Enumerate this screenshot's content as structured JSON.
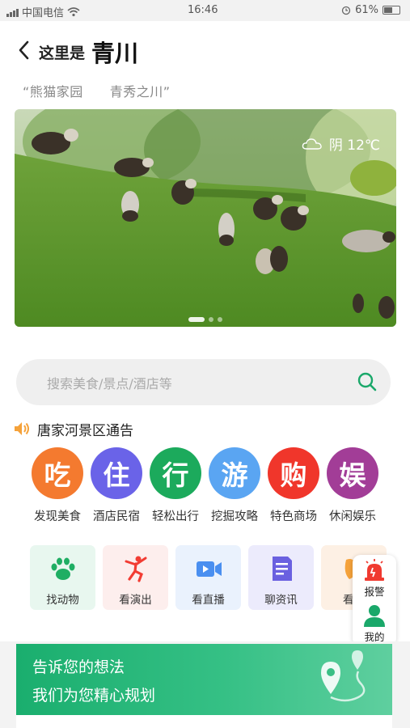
{
  "status_bar": {
    "carrier": "中国电信",
    "time": "16:46",
    "battery": "61%"
  },
  "header": {
    "prefix": "这里是",
    "title": "青川",
    "subtitle": "“熊猫家园　　青秀之川”"
  },
  "banner": {
    "weather_text": "阴 12℃",
    "weather_icon": "cloud-icon",
    "slide_count": 3,
    "active_slide": 1
  },
  "search": {
    "placeholder": "搜索美食/景点/酒店等",
    "icon": "search-icon"
  },
  "notice": {
    "icon": "speaker-icon",
    "text": "唐家河景区通告"
  },
  "categories": [
    {
      "char": "吃",
      "label": "发现美食",
      "color": "#f47a2f"
    },
    {
      "char": "住",
      "label": "酒店民宿",
      "color": "#6a63e8"
    },
    {
      "char": "行",
      "label": "轻松出行",
      "color": "#1caa5c"
    },
    {
      "char": "游",
      "label": "挖掘攻略",
      "color": "#5aa5f2"
    },
    {
      "char": "购",
      "label": "特色商场",
      "color": "#f0362b"
    },
    {
      "char": "娱",
      "label": "休闲娱乐",
      "color": "#a23d97"
    }
  ],
  "cards": [
    {
      "label": "找动物",
      "icon": "paw-icon",
      "bg": "#e8f7ef",
      "color": "#1fae63"
    },
    {
      "label": "看演出",
      "icon": "dancer-icon",
      "bg": "#fdeeed",
      "color": "#f23c33"
    },
    {
      "label": "看直播",
      "icon": "video-camera-icon",
      "bg": "#eaf2fd",
      "color": "#4a8ff0"
    },
    {
      "label": "聊资讯",
      "icon": "document-icon",
      "bg": "#ecebfc",
      "color": "#6a60e0"
    },
    {
      "label": "看手",
      "icon": "leaf-icon",
      "bg": "#fdf0e4",
      "color": "#f5a23a"
    }
  ],
  "floating": {
    "alarm_label": "报警",
    "alarm_icon": "alarm-siren-icon",
    "profile_label": "我的",
    "profile_icon": "user-icon"
  },
  "feedback": {
    "line1": "告诉您的想法",
    "line2": "我们为您精心规划",
    "icon": "map-route-icon"
  }
}
